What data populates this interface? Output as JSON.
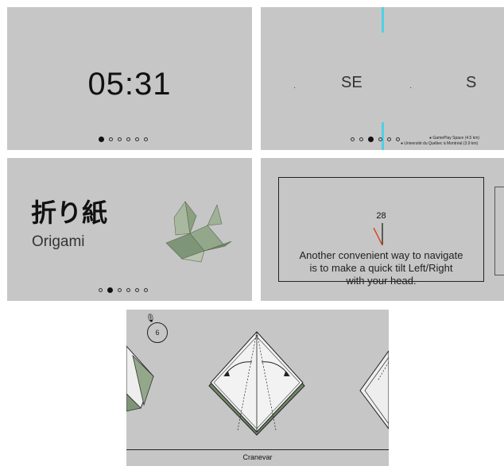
{
  "clock_card": {
    "time": "05:31",
    "page_dots": [
      true,
      false,
      false,
      false,
      false,
      false
    ]
  },
  "compass_card": {
    "headings": [
      "SE",
      "S"
    ],
    "ticks": [
      "·",
      "·"
    ],
    "page_dots": [
      false,
      false,
      true,
      false,
      false,
      false
    ],
    "places": [
      "GamePlay Space (4.5 km)",
      "Université du Québec à Montréal (3.9 km)"
    ],
    "accent_color": "#4fd0e0"
  },
  "title_card": {
    "title_japanese": "折り紙",
    "title_romaji": "Origami",
    "page_dots": [
      false,
      true,
      false,
      false,
      false,
      false
    ]
  },
  "tilt_card": {
    "tilt_value": "28",
    "message_lines": [
      "Another convenient way to navigate",
      "is to make a quick tilt Left/Right",
      "with your head."
    ],
    "needle_color": "#e04020"
  },
  "instructions_card": {
    "mic_icon": "microphone-icon",
    "step_number": "6",
    "footer_label": "Cranevar"
  }
}
